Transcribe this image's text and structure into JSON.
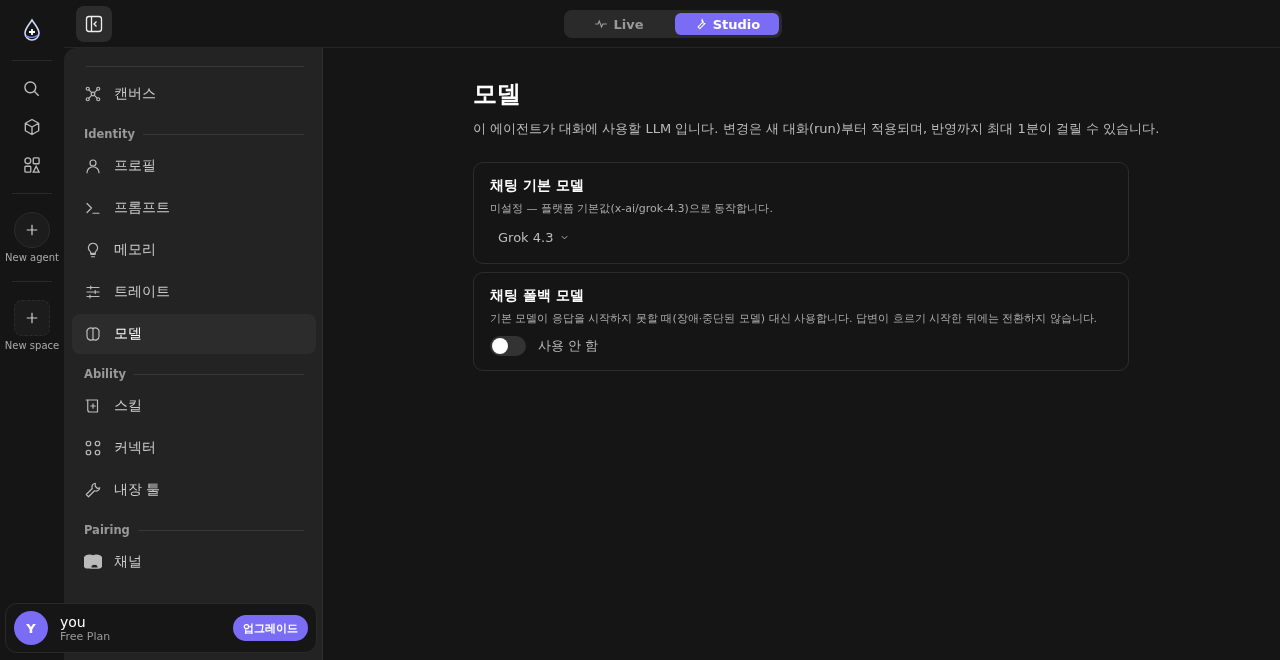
{
  "rail": {
    "items": [
      {
        "label": "New agent"
      },
      {
        "label": "New space"
      }
    ]
  },
  "mode_switch": [
    {
      "label": "Live",
      "selected": false
    },
    {
      "label": "Studio",
      "selected": true
    }
  ],
  "sidebar": {
    "sections": [
      {
        "items": [
          {
            "label": "캔버스",
            "selected": false
          }
        ]
      },
      {
        "title": "Identity",
        "items": [
          {
            "label": "프로필",
            "selected": false
          },
          {
            "label": "프롬프트",
            "selected": false
          },
          {
            "label": "메모리",
            "selected": false
          },
          {
            "label": "트레이트",
            "selected": false
          },
          {
            "label": "모델",
            "selected": true
          }
        ]
      },
      {
        "title": "Ability",
        "items": [
          {
            "label": "스킬",
            "selected": false
          },
          {
            "label": "커넥터",
            "selected": false
          },
          {
            "label": "내장 툴",
            "selected": false
          }
        ]
      },
      {
        "title": "Pairing",
        "items": [
          {
            "label": "채널",
            "selected": false
          }
        ]
      }
    ]
  },
  "user": {
    "initial": "Y",
    "name": "you",
    "plan": "Free Plan",
    "upgrade": "업그레이드"
  },
  "page": {
    "title": "모델",
    "description": "이 에이전트가 대화에 사용할 LLM 입니다. 변경은 새 대화(run)부터 적용되며, 반영까지 최대 1분이 걸릴 수 있습니다.",
    "cards": [
      {
        "kind": "select",
        "title": "채팅 기본 모델",
        "description": "미설정 — 플랫폼 기본값(x-ai/grok-4.3)으로 동작합니다.",
        "value": "Grok 4.3"
      },
      {
        "kind": "toggle",
        "title": "채팅 폴백 모델",
        "description": "기본 모델이 응답을 시작하지 못할 때(장애·중단된 모델) 대신 사용합니다. 답변이 흐르기 시작한 뒤에는 전환하지 않습니다.",
        "on": false,
        "toggle_label": "사용 안 함"
      }
    ]
  }
}
